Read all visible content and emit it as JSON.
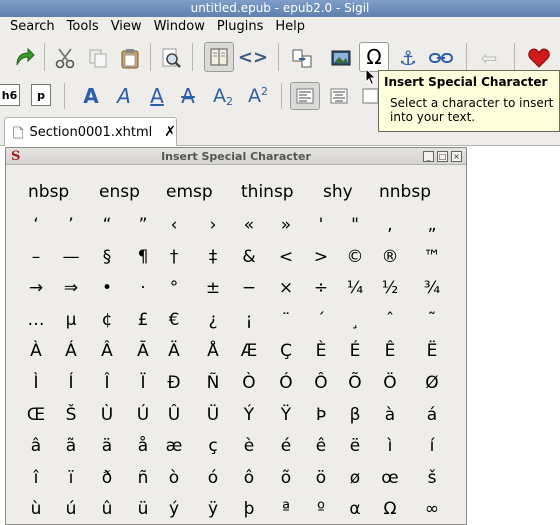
{
  "window": {
    "title": "untitled.epub - epub2.0 - Sigil"
  },
  "menu": [
    "Search",
    "Tools",
    "View",
    "Window",
    "Plugins",
    "Help"
  ],
  "format_bar": {
    "h6": "h6",
    "p": "p"
  },
  "tab": {
    "label": "Section0001.xhtml"
  },
  "tooltip": {
    "title": "Insert Special Character",
    "body": "Select a character to insert into your text."
  },
  "dialog": {
    "title": "Insert Special Character",
    "named_entities": [
      "nbsp",
      "ensp",
      "emsp",
      "thinsp",
      "shy",
      "nnbsp"
    ],
    "rows": [
      [
        "‘",
        "’",
        "“",
        "”",
        "‹",
        "›",
        "«",
        "»",
        "'",
        "\"",
        ",",
        "„"
      ],
      [
        "–",
        "—",
        "§",
        "¶",
        "†",
        "‡",
        "&",
        "<",
        ">",
        "©",
        "®",
        "™"
      ],
      [
        "→",
        "⇒",
        "•",
        "·",
        "°",
        "±",
        "−",
        "×",
        "÷",
        "¼",
        "½",
        "¾"
      ],
      [
        "…",
        "µ",
        "¢",
        "£",
        "€",
        "¿",
        "¡",
        "¨",
        "´",
        "¸",
        "ˆ",
        "˜"
      ],
      [
        "À",
        "Á",
        "Â",
        "Ã",
        "Ä",
        "Å",
        "Æ",
        "Ç",
        "È",
        "É",
        "Ê",
        "Ë"
      ],
      [
        "Ì",
        "Í",
        "Î",
        "Ï",
        "Ð",
        "Ñ",
        "Ò",
        "Ó",
        "Ô",
        "Õ",
        "Ö",
        "Ø"
      ],
      [
        "Œ",
        "Š",
        "Ù",
        "Ú",
        "Û",
        "Ü",
        "Ý",
        "Ÿ",
        "Þ",
        "β",
        "à",
        "á"
      ],
      [
        "â",
        "ã",
        "ä",
        "å",
        "æ",
        "ç",
        "è",
        "é",
        "ê",
        "ë",
        "ì",
        "í"
      ],
      [
        "î",
        "ï",
        "ð",
        "ñ",
        "ò",
        "ó",
        "ô",
        "õ",
        "ö",
        "ø",
        "œ",
        "š"
      ],
      [
        "ù",
        "ú",
        "û",
        "ü",
        "ý",
        "ÿ",
        "þ",
        "ª",
        "º",
        "α",
        "Ω",
        "∞"
      ]
    ]
  },
  "icons": {
    "redo": "redo-icon",
    "cut": "cut-icon",
    "copy": "copy-icon",
    "paste": "paste-icon",
    "find": "find-replace-icon",
    "book_view": "book-view-icon",
    "code_view": "code-view-icon",
    "split": "split-section-icon",
    "insert_image": "insert-image-icon",
    "special_char": "special-character-icon",
    "anchor": "anchor-icon",
    "link": "link-icon",
    "back": "back-icon",
    "donate": "heart-icon"
  },
  "colors": {
    "accent": "#5f80ad",
    "tooltip_bg": "#ffffdc",
    "heart": "#d11a1a",
    "redo": "#3a9a2a"
  }
}
